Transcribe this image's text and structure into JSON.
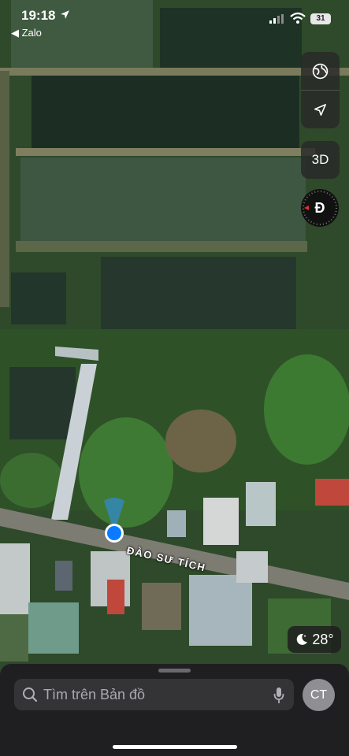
{
  "status_bar": {
    "time": "19:18",
    "back_app": "◀ Zalo",
    "battery": "31"
  },
  "map": {
    "road_label": "ĐÀO SƯ TÍCH",
    "type": "satellite"
  },
  "controls": {
    "globe_icon": "globe-icon",
    "location_icon": "location-arrow-icon",
    "three_d": "3D",
    "compass": "Đ"
  },
  "weather": {
    "icon": "moon-icon",
    "temperature": "28°"
  },
  "search": {
    "placeholder": "Tìm trên Bản đồ"
  },
  "account": {
    "initials": "CT"
  }
}
